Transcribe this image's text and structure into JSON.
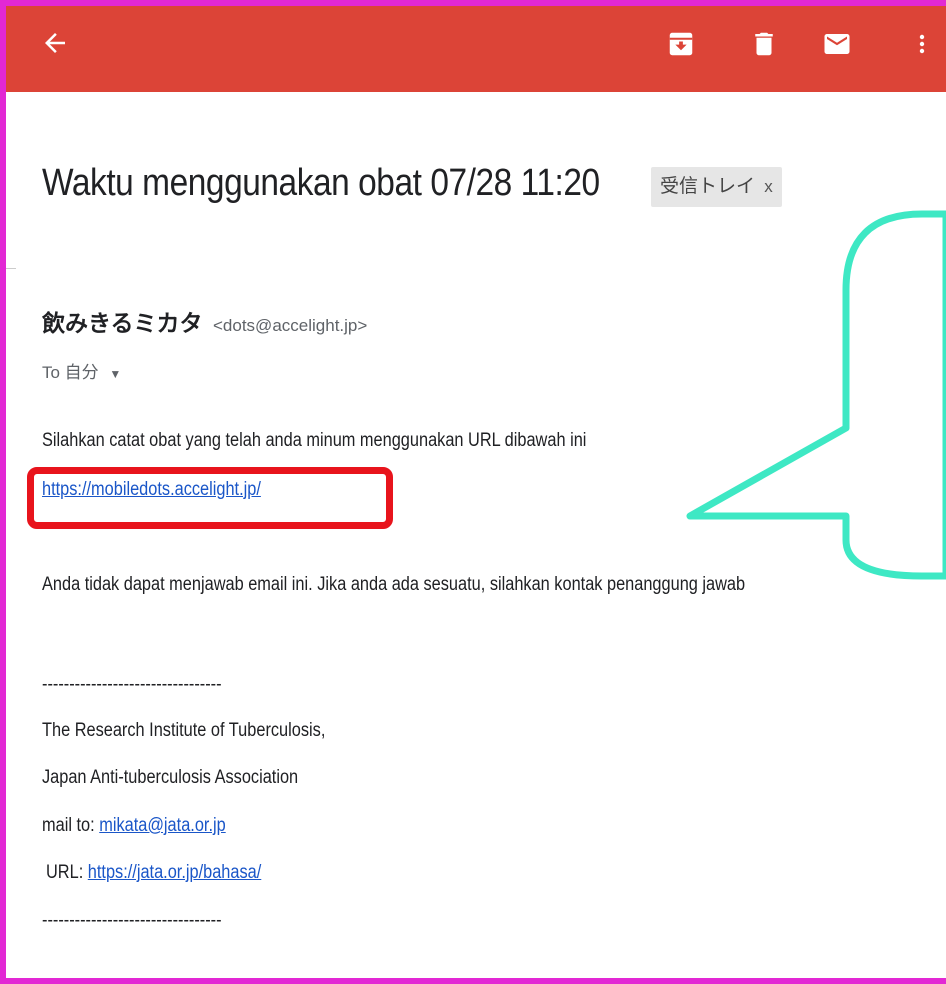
{
  "appbar": {
    "color": "#dc4437",
    "icons": [
      "back-arrow-icon",
      "archive-icon",
      "trash-icon",
      "mail-icon",
      "more-vert-icon"
    ]
  },
  "message": {
    "subject": "Waktu menggunakan obat 07/28 11:20",
    "label": "受信トレイ",
    "label_close": "x",
    "sender_name": "飲みきるミカタ",
    "sender_email": "<dots@accelight.jp>",
    "to": "To 自分",
    "body_line1": "Silahkan catat obat yang telah anda minum menggunakan URL dibawah ini",
    "body_link": "https://mobiledots.accelight.jp/",
    "body_line2": "Anda tidak dapat menjawab email ini. Jika anda ada sesuatu, silahkan kontak penanggung jawab",
    "separator_top": "---------------------------------",
    "sig_line1": "The Research Institute of Tuberculosis,",
    "sig_line2": "Japan Anti-tuberculosis Association",
    "sig_mail_prefix": "mail to:",
    "sig_mail": "mikata@jata.or.jp",
    "sig_url_prefix": "URL:",
    "sig_url": "https://jata.or.jp/bahasa/",
    "separator_bottom": "---------------------------------"
  },
  "annotations": {
    "frame_color": "#e228d4",
    "highlight_color": "#e8141c",
    "callout_color": "#3ee8c4"
  }
}
